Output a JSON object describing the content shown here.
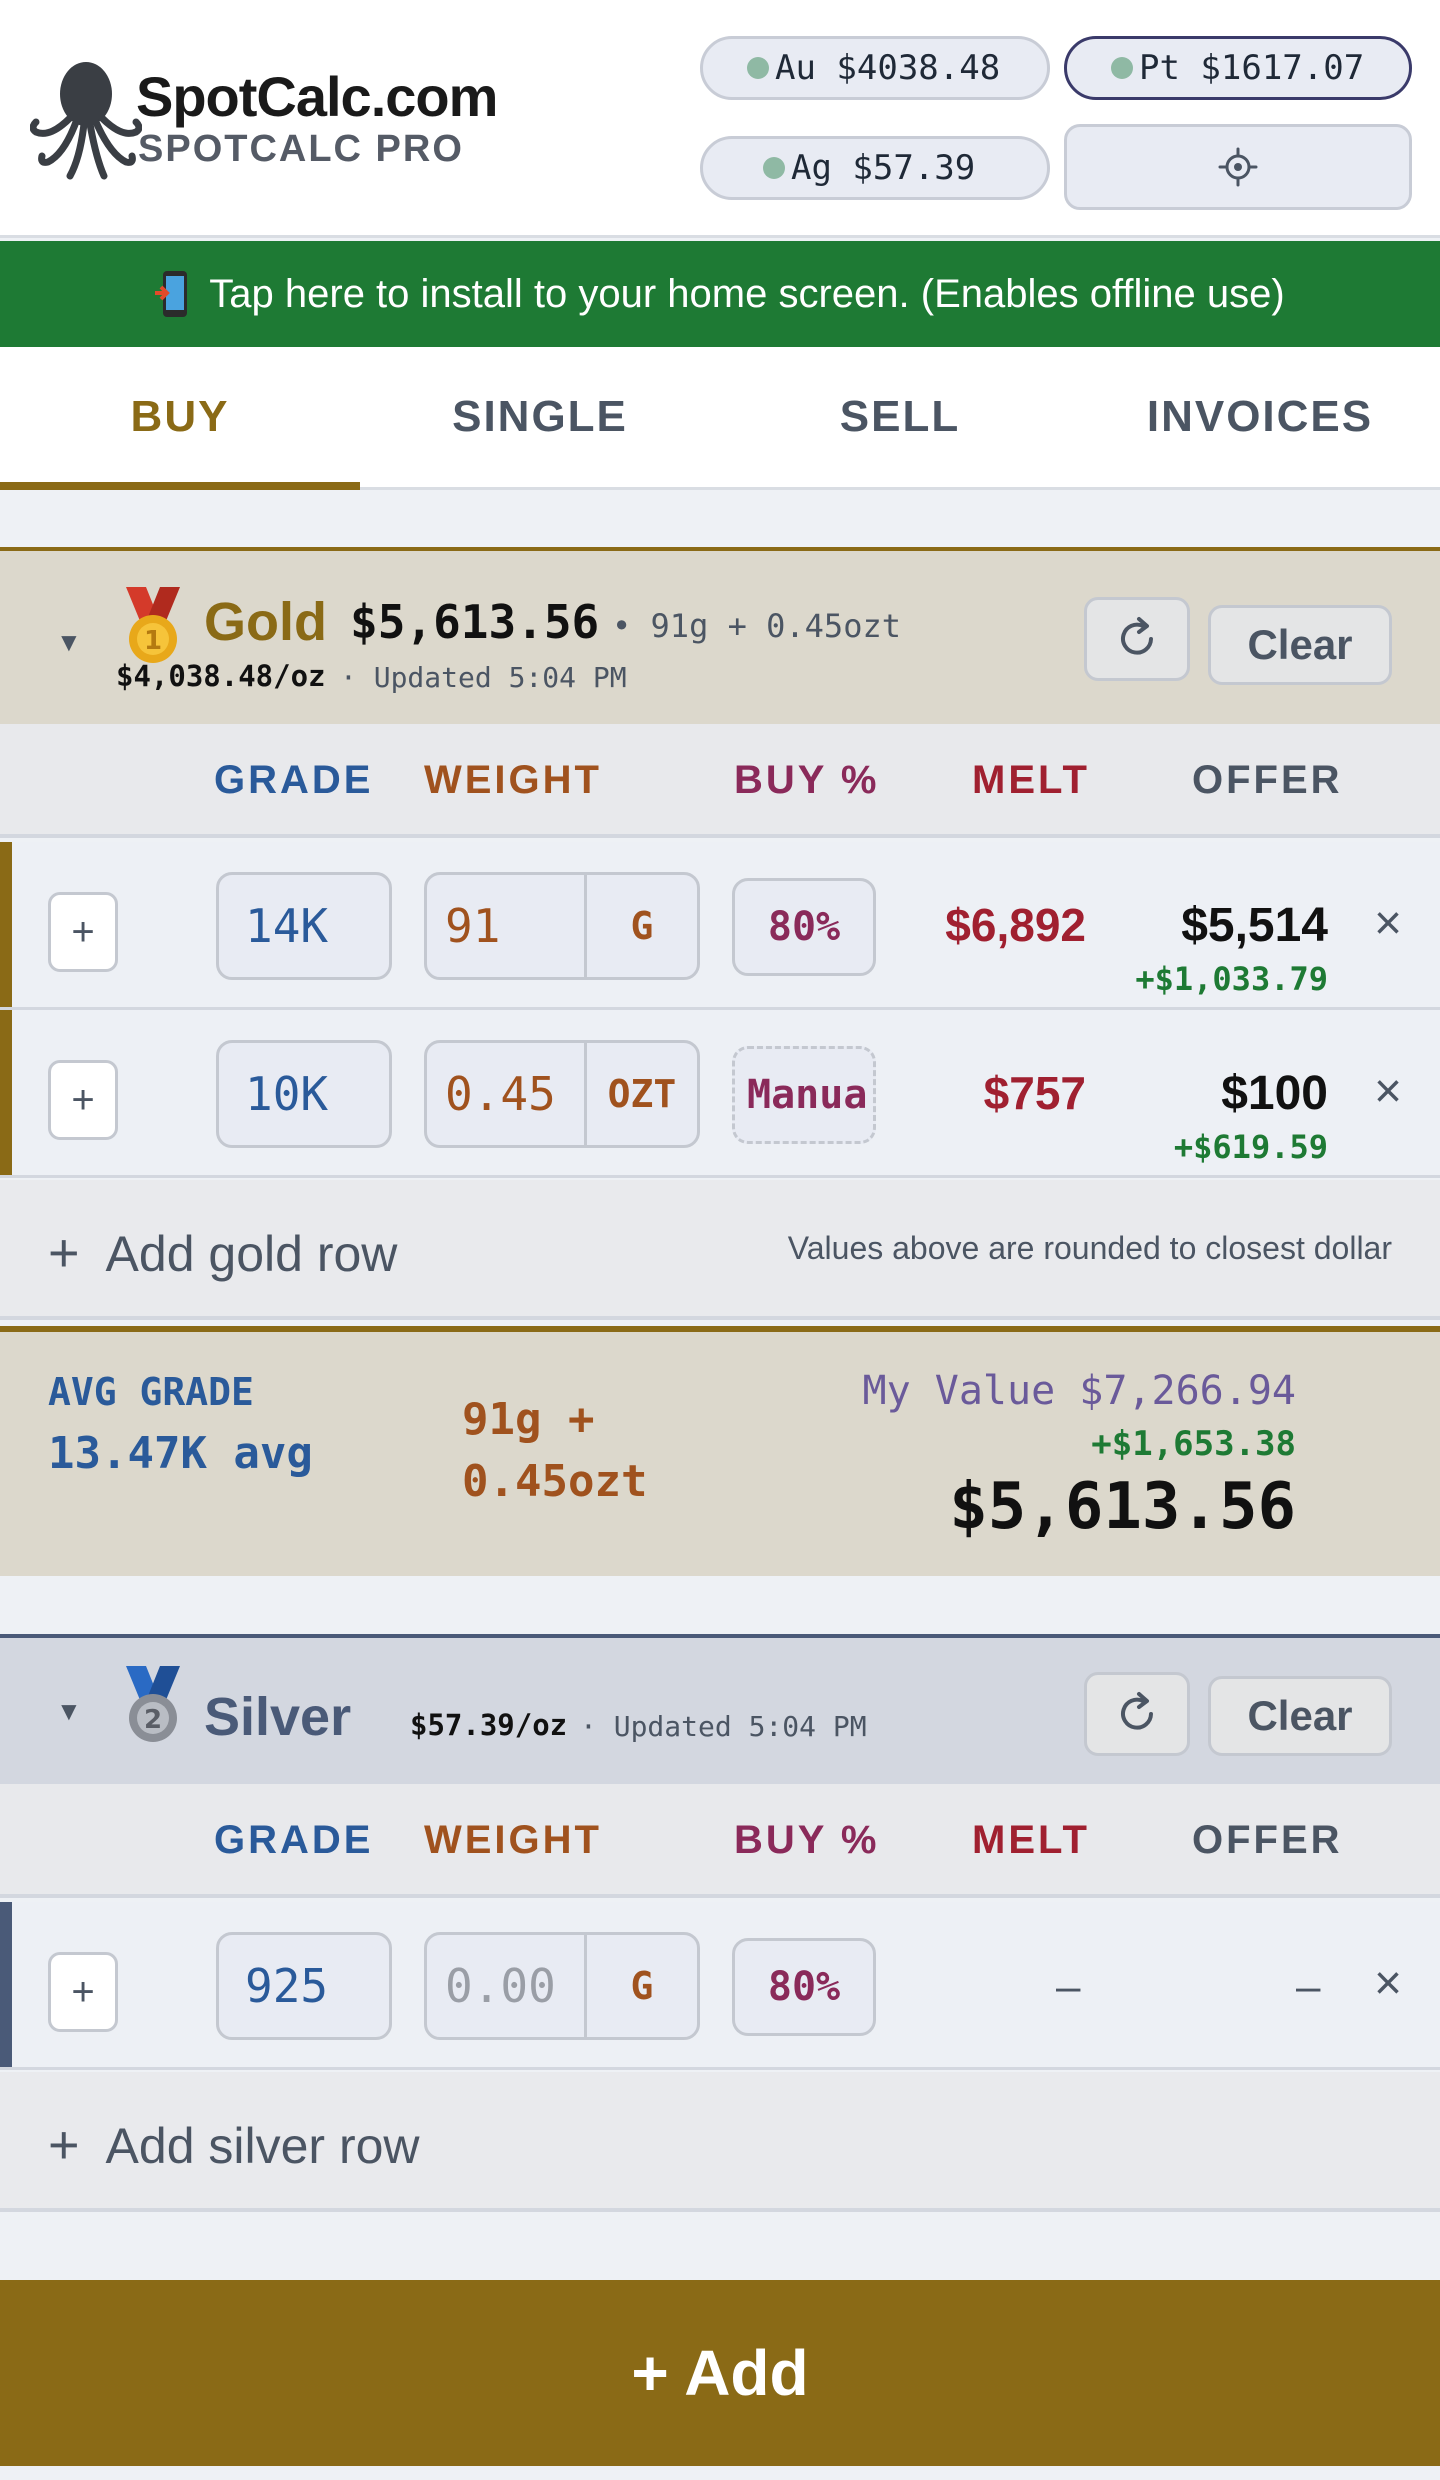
{
  "app": {
    "brand": "SpotCalc.com",
    "subtitle": "SPOTCALC PRO"
  },
  "spot": {
    "au": "Au $4038.48",
    "pt": "Pt $1617.07",
    "ag": "Ag $57.39"
  },
  "banner": {
    "text": "Tap here to install to your home screen. (Enables offline use)"
  },
  "tabs": [
    {
      "label": "BUY",
      "active": true
    },
    {
      "label": "SINGLE",
      "active": false
    },
    {
      "label": "SELL",
      "active": false
    },
    {
      "label": "INVOICES",
      "active": false
    }
  ],
  "columns": {
    "grade": "GRADE",
    "weight": "WEIGHT",
    "buy": "BUY %",
    "melt": "MELT",
    "offer": "OFFER"
  },
  "gold": {
    "title": "Gold",
    "total": "$5,613.56",
    "summary": "• 91g + 0.45ozt",
    "price": "$4,038.48/oz",
    "updated": "· Updated 5:04 PM",
    "clear": "Clear",
    "rows": [
      {
        "plus": "+",
        "grade": "14K",
        "weight": "91",
        "unit": "G",
        "buy": "80%",
        "melt": "$6,892",
        "offer": "$5,514",
        "diff": "+$1,033.79",
        "remove": "×"
      },
      {
        "plus": "+",
        "grade": "10K",
        "weight": "0.45",
        "unit": "OZT",
        "buy": "Manua",
        "melt": "$757",
        "offer": "$100",
        "diff": "+$619.59",
        "remove": "×"
      }
    ],
    "add_row": "Add gold row",
    "add_plus": "+",
    "note": "Values above are rounded to closest dollar"
  },
  "gold_summary": {
    "avg_label": "AVG GRADE",
    "avg_value": "13.47K avg",
    "weight_line1": "91g +",
    "weight_line2": "0.45ozt",
    "my_value": "My Value $7,266.94",
    "diff": "+$1,653.38",
    "total": "$5,613.56"
  },
  "silver": {
    "title": "Silver",
    "price": "$57.39/oz",
    "updated": "· Updated 5:04 PM",
    "clear": "Clear",
    "rows": [
      {
        "plus": "+",
        "grade": "925",
        "weight_placeholder": "0.00",
        "unit": "G",
        "buy": "80%",
        "melt": "–",
        "offer": "–",
        "remove": "×"
      }
    ],
    "add_row": "Add silver row",
    "add_plus": "+"
  },
  "footer": {
    "add_label": "+  Add"
  },
  "colors": {
    "gold": "#8a6a16",
    "green": "#1e7a34",
    "melt": "#a02030",
    "grade": "#2a5a9a",
    "weight": "#a0521e",
    "buy": "#8a2a5a",
    "silver": "#4a5a78"
  }
}
